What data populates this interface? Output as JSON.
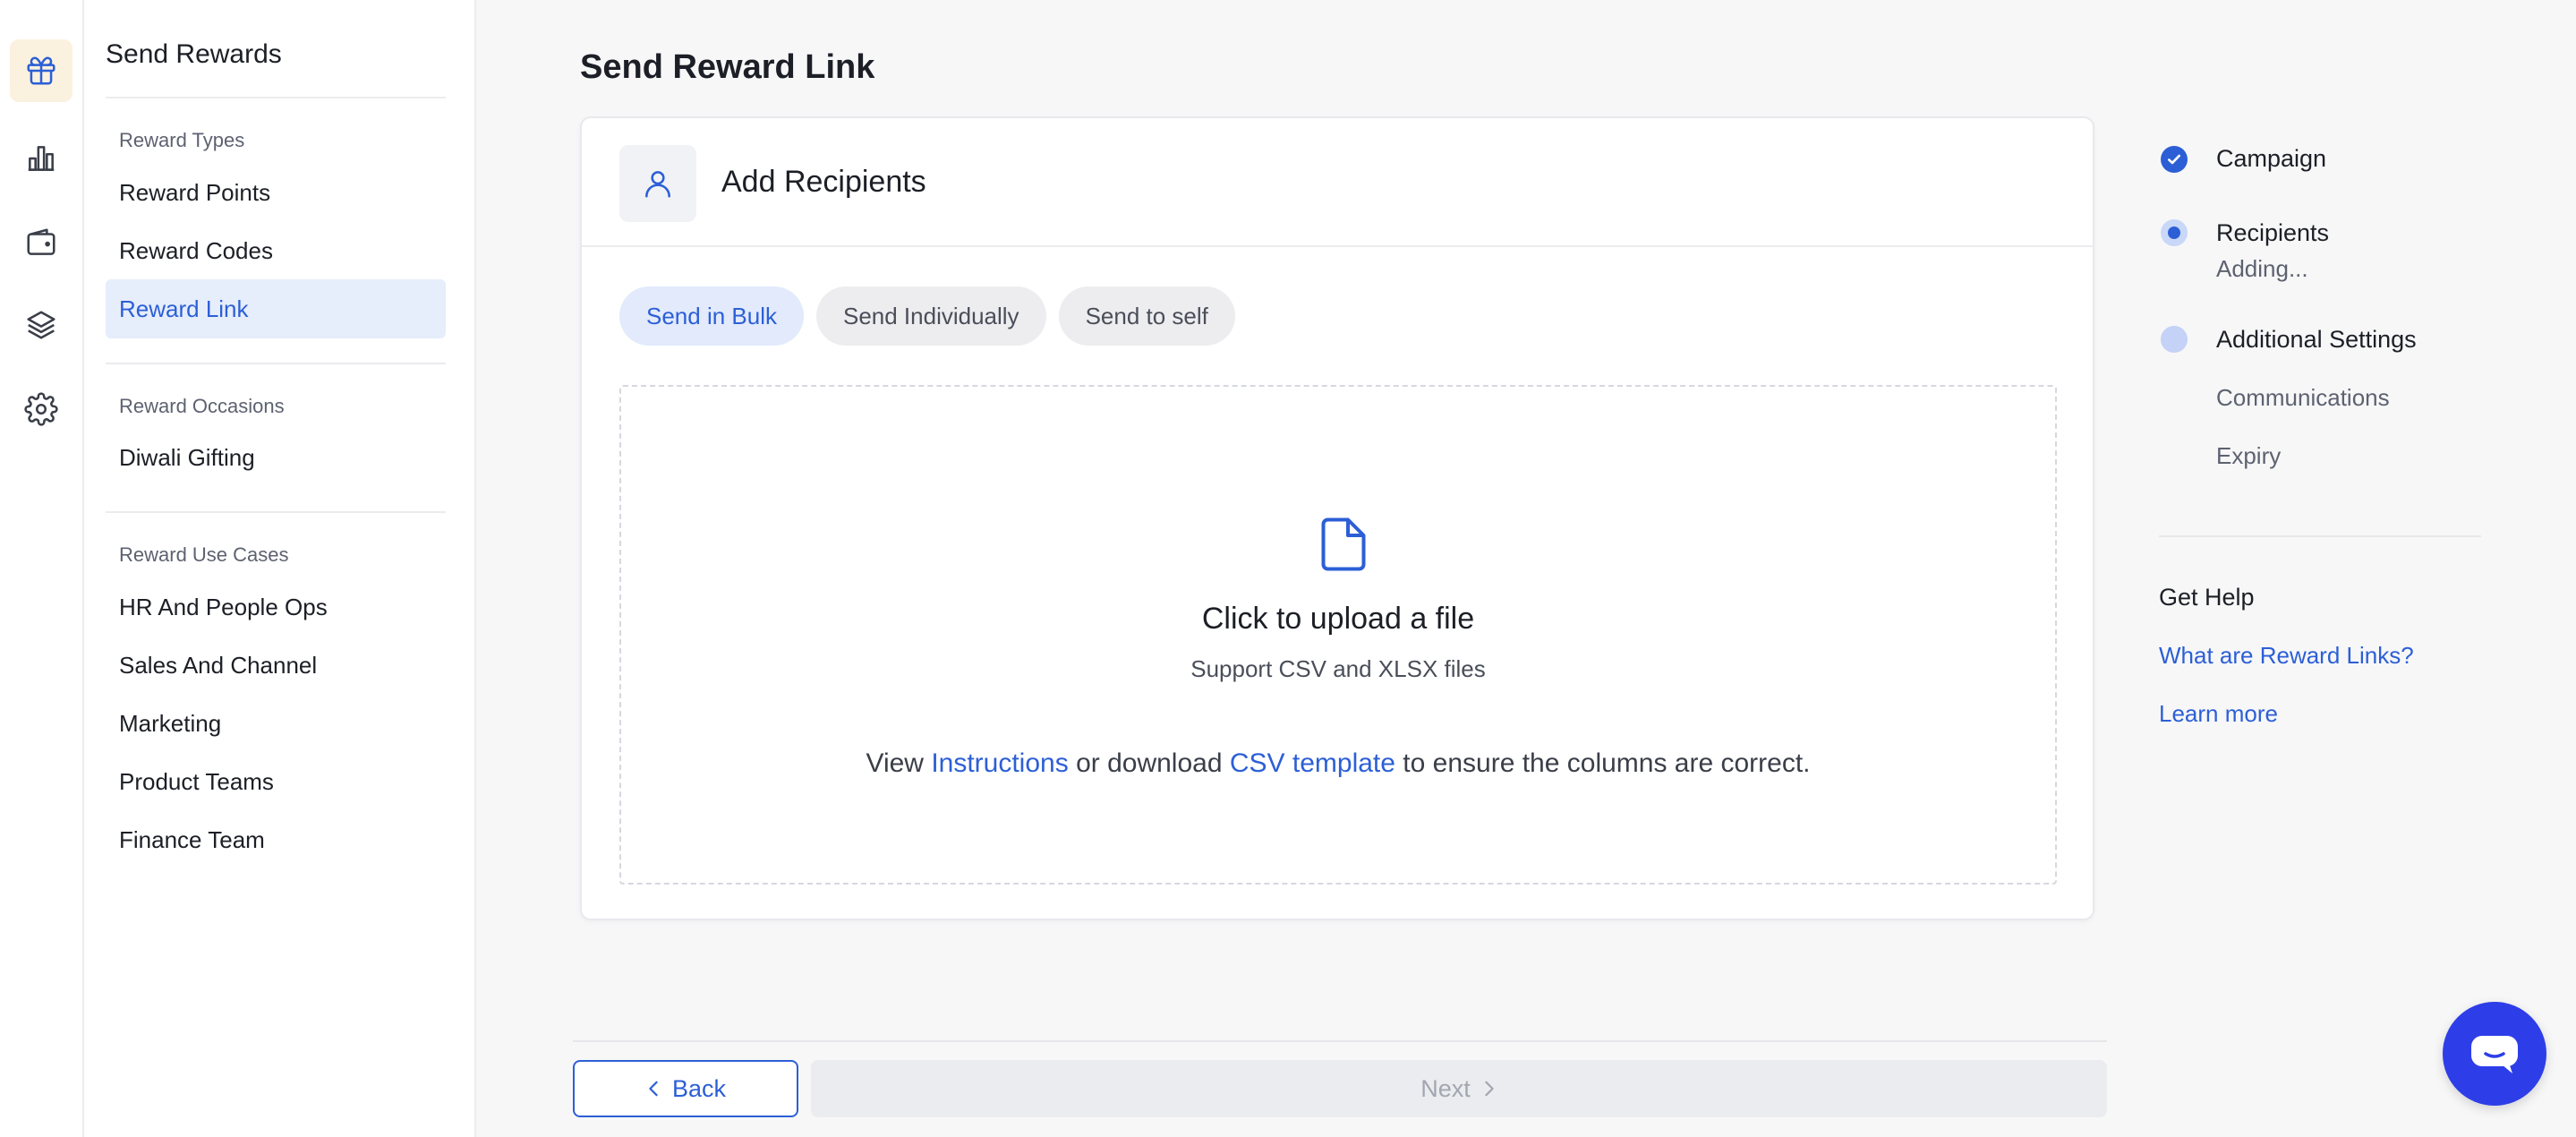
{
  "rail": {
    "icons": [
      "gift-icon",
      "bar-chart-icon",
      "wallet-icon",
      "layers-icon",
      "gear-icon"
    ]
  },
  "sidebar": {
    "title": "Send Rewards",
    "groups": [
      {
        "label": "Reward Types",
        "items": [
          "Reward Points",
          "Reward Codes",
          "Reward Link"
        ]
      },
      {
        "label": "Reward Occasions",
        "items": [
          "Diwali Gifting"
        ]
      },
      {
        "label": "Reward Use Cases",
        "items": [
          "HR And People Ops",
          "Sales And Channel",
          "Marketing",
          "Product Teams",
          "Finance Team"
        ]
      }
    ],
    "active_item": "Reward Link"
  },
  "main": {
    "title": "Send Reward Link",
    "card": {
      "title": "Add Recipients",
      "tabs": [
        "Send in Bulk",
        "Send Individually",
        "Send to self"
      ],
      "active_tab": "Send in Bulk",
      "upload": {
        "title": "Click to upload a file",
        "subtitle": "Support CSV and XLSX files",
        "help_prefix": "View",
        "help_link1": "Instructions",
        "help_middle": "or download",
        "help_link2": "CSV template",
        "help_suffix": "to ensure the columns are correct."
      }
    },
    "footer": {
      "back_label": "Back",
      "next_label": "Next"
    }
  },
  "stepper": {
    "steps": [
      {
        "label": "Campaign",
        "state": "done"
      },
      {
        "label": "Recipients",
        "sub": "Adding...",
        "state": "current"
      },
      {
        "label": "Additional Settings",
        "state": "pending",
        "children": [
          "Communications",
          "Expiry"
        ]
      }
    ]
  },
  "help": {
    "title": "Get Help",
    "links": [
      "What are Reward Links?",
      "Learn more"
    ]
  },
  "colors": {
    "accent": "#2c5fd6",
    "chat_fab": "#2d3ee8",
    "active_rail_bg": "#fbf1df"
  }
}
